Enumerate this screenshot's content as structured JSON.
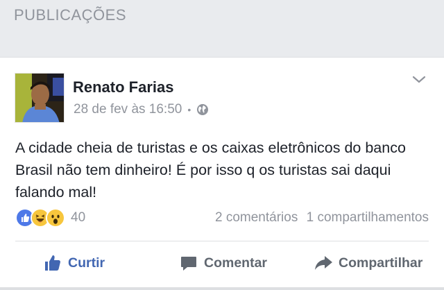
{
  "section": {
    "title": "PUBLICAÇÕES"
  },
  "post": {
    "author": "Renato Farias",
    "timestamp": "28 de fev às 16:50",
    "separator": "•",
    "privacy_icon": "globe-icon",
    "text": "A cidade cheia de turistas e os caixas eletrônicos do banco Brasil não tem dinheiro! É por isso  q os turistas sai daqui falando mal!",
    "reactions": {
      "types": [
        "like",
        "haha",
        "wow"
      ],
      "count": "40"
    },
    "comments": "2 comentários",
    "shares": "1 compartilhamentos"
  },
  "actions": {
    "like": "Curtir",
    "comment": "Comentar",
    "share": "Compartilhar"
  },
  "colors": {
    "accent": "#4267b2",
    "muted": "#90949c",
    "text": "#1d2129",
    "background": "#e9ebee"
  }
}
